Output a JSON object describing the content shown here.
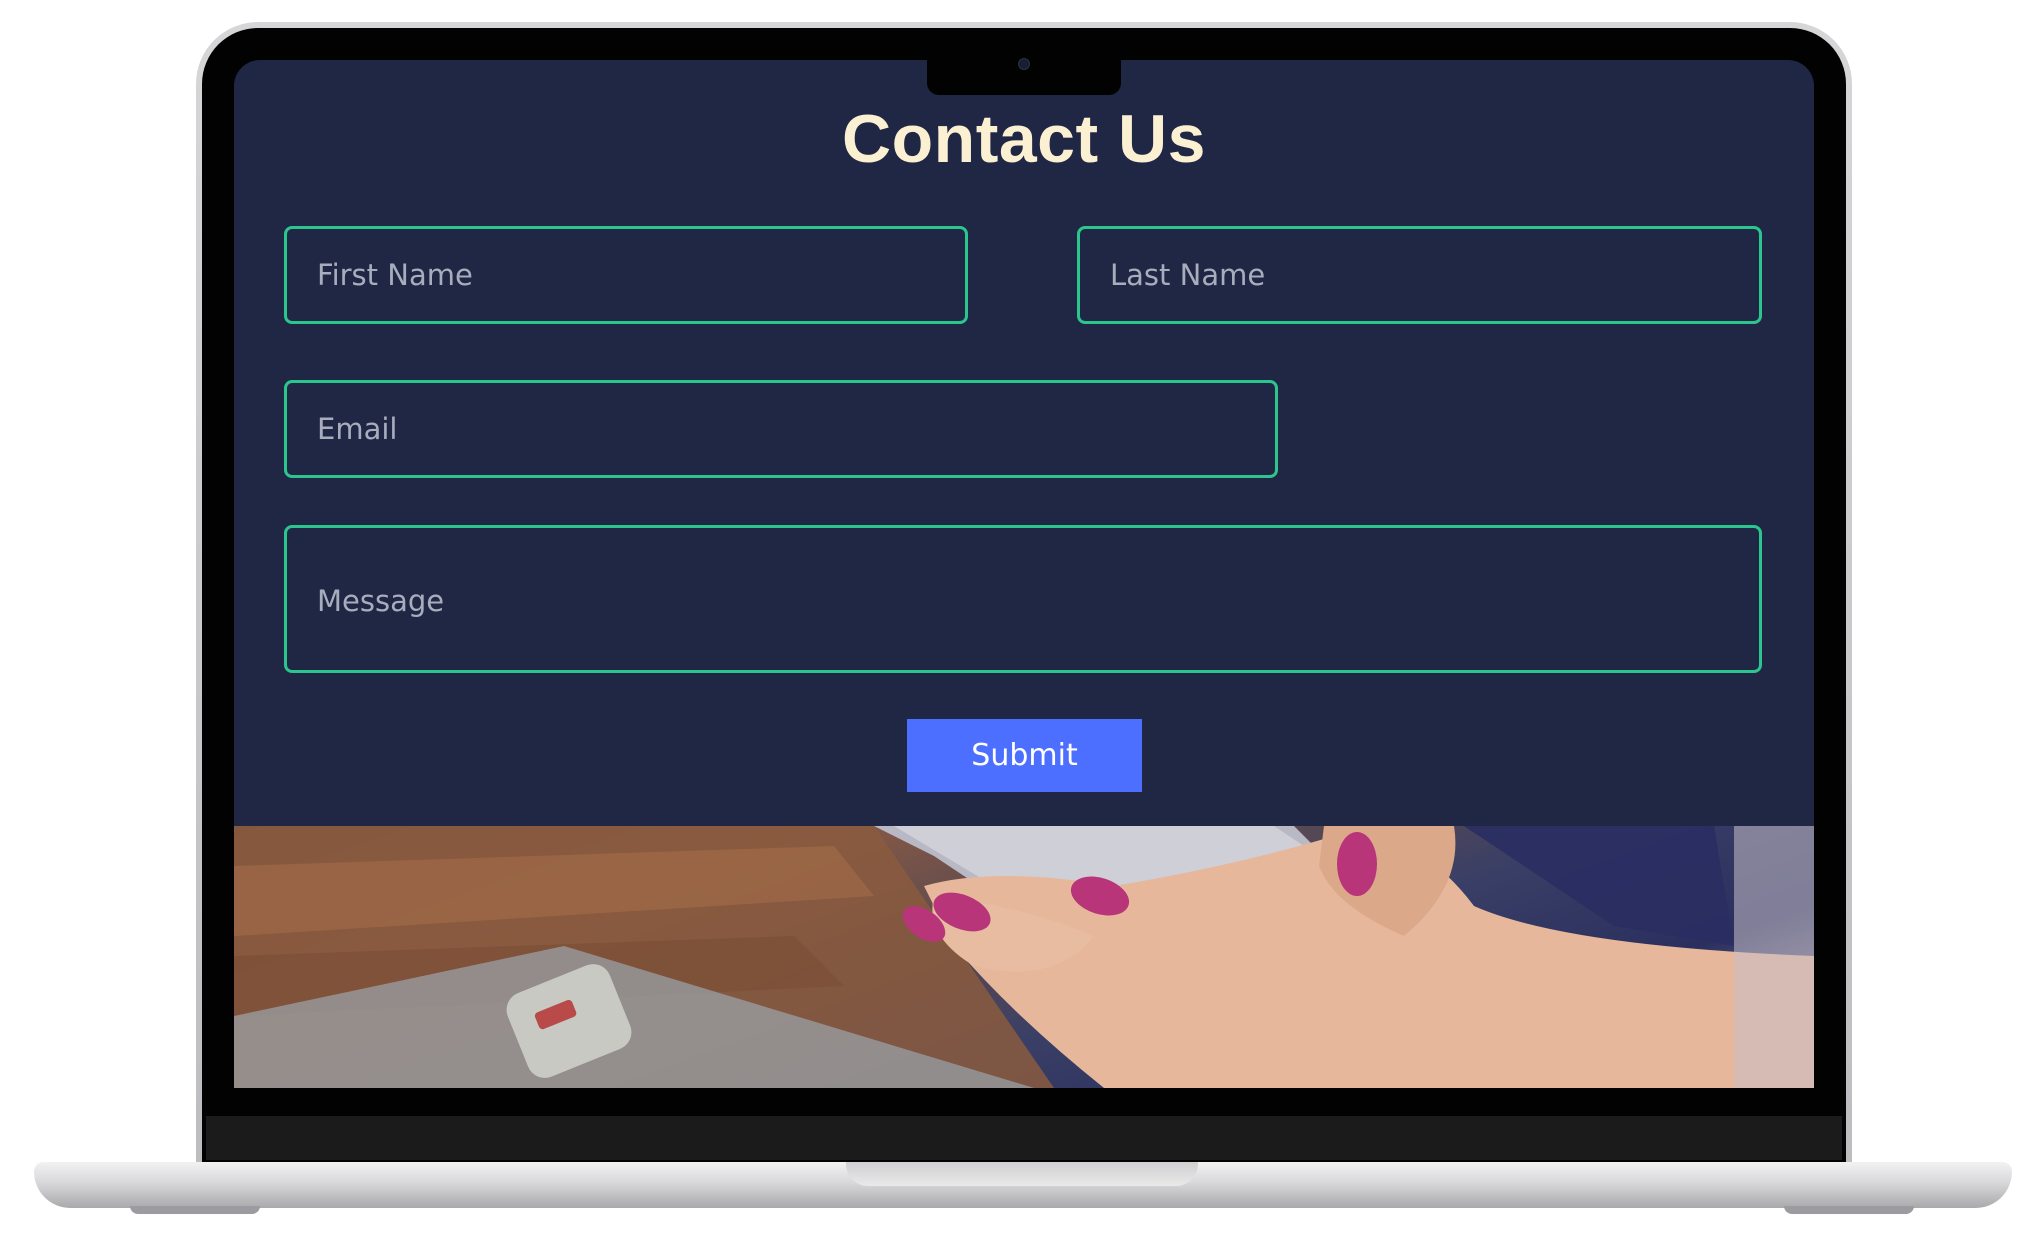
{
  "form": {
    "title": "Contact Us",
    "first_name_placeholder": "First Name",
    "last_name_placeholder": "Last Name",
    "email_placeholder": "Email",
    "message_placeholder": "Message",
    "submit_label": "Submit"
  },
  "colors": {
    "screen_background": "#1f2744",
    "title_text": "#fbf1d2",
    "field_border": "#2bc58d",
    "submit_background": "#4d6fff"
  },
  "photo": {
    "description_icon": "hand-holding-phone-photo"
  }
}
